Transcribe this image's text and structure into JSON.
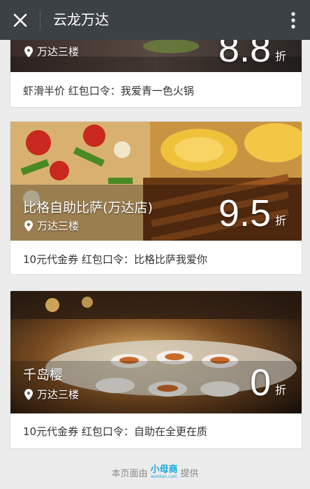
{
  "header": {
    "title": "云龙万达",
    "close_icon": "close-icon",
    "more_icon": "more-vertical-icon"
  },
  "cards": [
    {
      "name": "",
      "location": "万达三楼",
      "discount": "8.8",
      "discount_unit": "折",
      "caption": "虾滑半价 红包口令：我爱青一色火锅"
    },
    {
      "name": "比格自助比萨(万达店)",
      "location": "万达三楼",
      "discount": "9.5",
      "discount_unit": "折",
      "caption": "10元代金券 红包口令：比格比萨我爱你"
    },
    {
      "name": "千岛樱",
      "location": "万达三楼",
      "discount": "0",
      "discount_unit": "折",
      "caption": "10元代金券 红包口令：自助在全更在质"
    }
  ],
  "footer": {
    "prefix": "本页面由",
    "brand": "小母商",
    "brand_sub": "weidian.com",
    "suffix": "提供"
  },
  "colors": {
    "topbar": "#3c4146",
    "page_bg": "#ececec",
    "brand": "#19a9e0"
  }
}
